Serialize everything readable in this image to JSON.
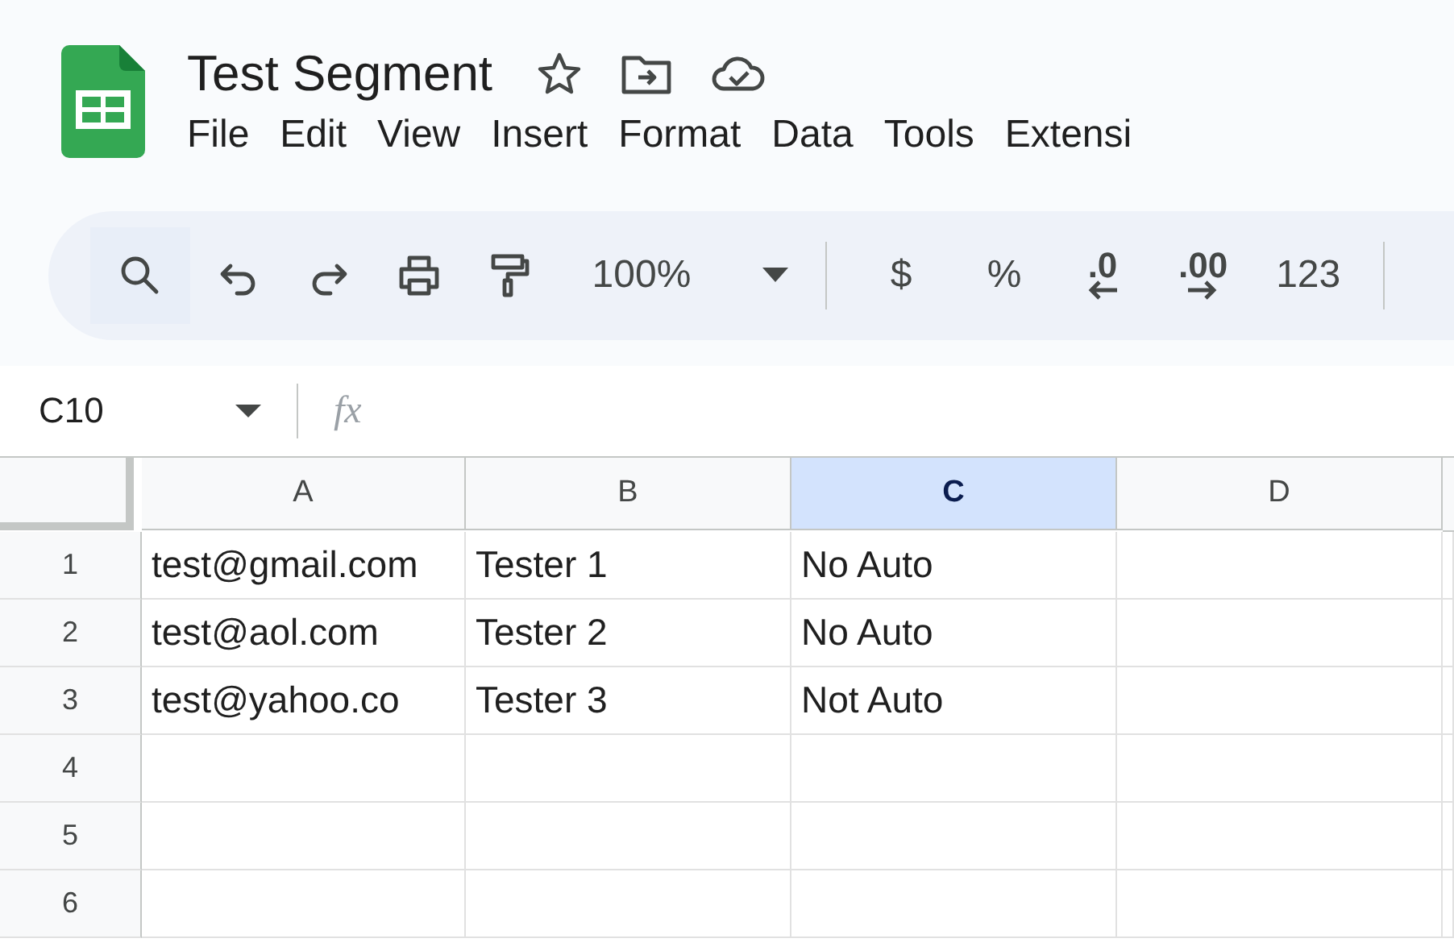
{
  "document": {
    "title": "Test Segment"
  },
  "menu": [
    "File",
    "Edit",
    "View",
    "Insert",
    "Format",
    "Data",
    "Tools",
    "Extensi"
  ],
  "toolbar": [
    {
      "kind": "search"
    },
    {
      "kind": "undo"
    },
    {
      "kind": "redo"
    },
    {
      "kind": "print"
    },
    {
      "kind": "paint"
    },
    {
      "kind": "zoom",
      "label": "100%"
    },
    {
      "kind": "divider"
    },
    {
      "kind": "text",
      "label": "$"
    },
    {
      "kind": "text",
      "label": "%"
    },
    {
      "kind": "decrease",
      "label": ".0"
    },
    {
      "kind": "increase",
      "label": ".00"
    },
    {
      "kind": "text",
      "label": "123"
    },
    {
      "kind": "divider"
    }
  ],
  "name_box": "C10",
  "formula_label": "fx",
  "columns": [
    {
      "label": "A",
      "selected": false
    },
    {
      "label": "B",
      "selected": false
    },
    {
      "label": "C",
      "selected": true
    },
    {
      "label": "D",
      "selected": false
    }
  ],
  "rows": [
    {
      "label": "1",
      "cells": [
        "test@gmail.com",
        "Tester 1",
        "No Auto",
        ""
      ]
    },
    {
      "label": "2",
      "cells": [
        "test@aol.com",
        "Tester 2",
        "No Auto",
        ""
      ]
    },
    {
      "label": "3",
      "cells": [
        "test@yahoo.co",
        "Tester 3",
        "Not Auto",
        ""
      ]
    },
    {
      "label": "4",
      "cells": [
        "",
        "",
        "",
        ""
      ]
    },
    {
      "label": "5",
      "cells": [
        "",
        "",
        "",
        ""
      ]
    },
    {
      "label": "6",
      "cells": [
        "",
        "",
        "",
        ""
      ]
    }
  ]
}
